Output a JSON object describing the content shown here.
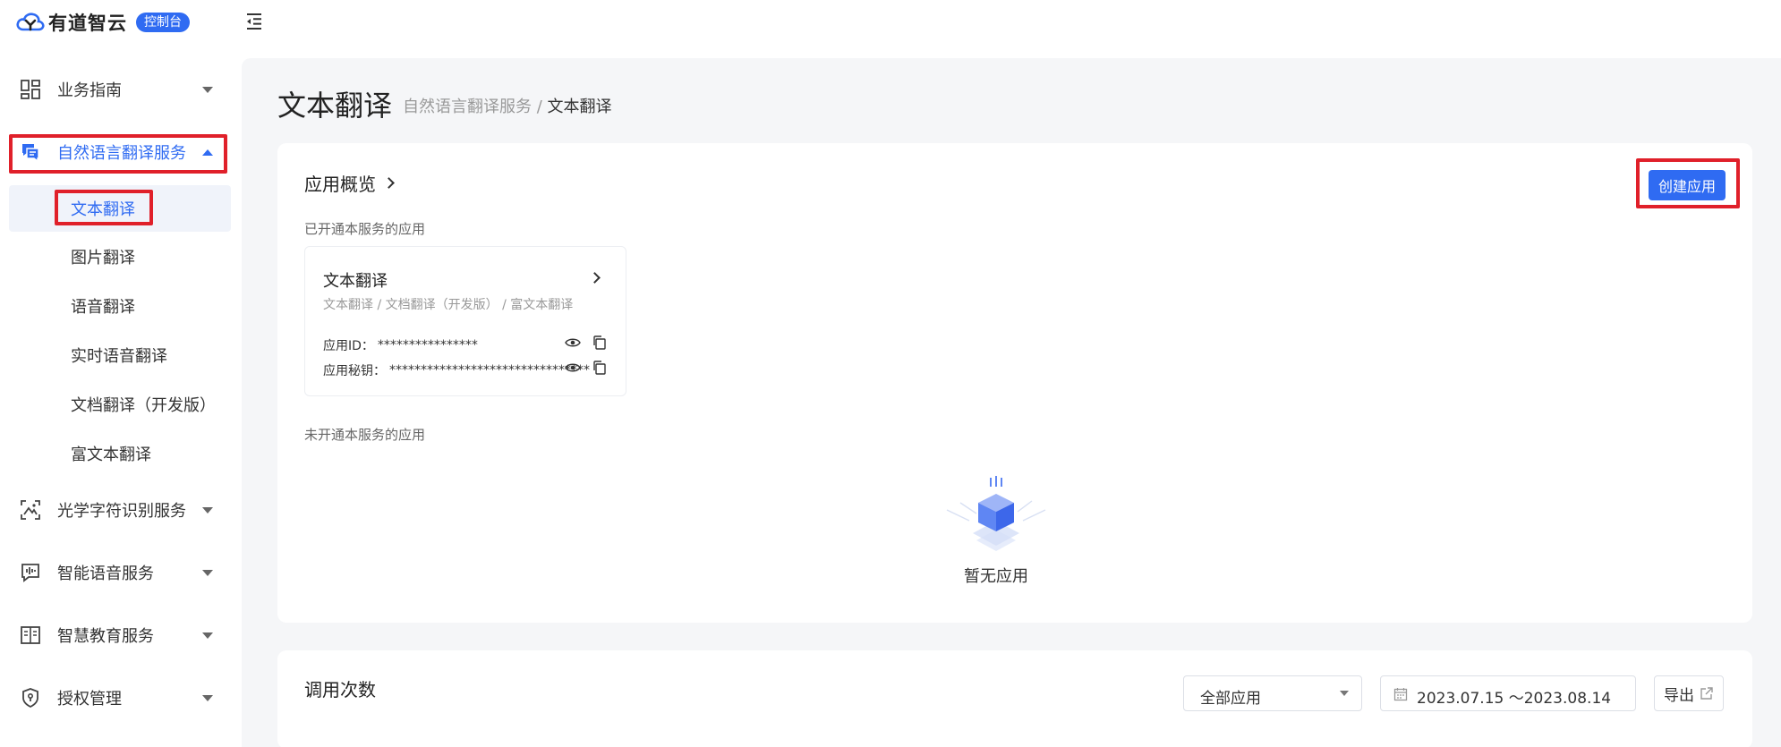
{
  "header": {
    "brand": "有道智云",
    "console_badge": "控制台"
  },
  "sidebar": {
    "groups": [
      {
        "label": "业务指南",
        "icon": "grid-icon"
      },
      {
        "label": "自然语言翻译服务",
        "icon": "chat-translate-icon"
      },
      {
        "label": "光学字符识别服务",
        "icon": "scan-image-icon"
      },
      {
        "label": "智能语音服务",
        "icon": "voice-wave-icon"
      },
      {
        "label": "智慧教育服务",
        "icon": "book-icon"
      },
      {
        "label": "授权管理",
        "icon": "shield-icon"
      }
    ],
    "sub_items": [
      {
        "label": "文本翻译"
      },
      {
        "label": "图片翻译"
      },
      {
        "label": "语音翻译"
      },
      {
        "label": "实时语音翻译"
      },
      {
        "label": "文档翻译（开发版）"
      },
      {
        "label": "富文本翻译"
      }
    ]
  },
  "main": {
    "title": "文本翻译",
    "breadcrumb": {
      "parent": "自然语言翻译服务",
      "separator": " / ",
      "current": "文本翻译"
    },
    "overview": {
      "title": "应用概览",
      "create_button": "创建应用",
      "enabled_heading": "已开通本服务的应用",
      "disabled_heading": "未开通本服务的应用",
      "app": {
        "name": "文本翻译",
        "services": "文本翻译 / 文档翻译（开发版） / 富文本翻译",
        "id_label": "应用ID：",
        "id_value": "****************",
        "secret_label": "应用秘钥：",
        "secret_value": "********************************"
      },
      "empty_text": "暂无应用"
    },
    "calls": {
      "title": "调用次数",
      "app_select": "全部应用",
      "date_range": "2023.07.15 ～2023.08.14",
      "export_button": "导出"
    }
  },
  "colors": {
    "accent": "#2f6bf2",
    "highlight": "#e0202a"
  }
}
